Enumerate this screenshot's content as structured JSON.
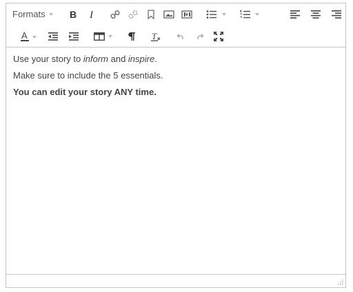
{
  "toolbar": {
    "formats_label": "Formats",
    "row1": [
      "bold-icon",
      "italic-icon",
      "link-icon",
      "unlink-icon",
      "bookmark-icon",
      "image-icon",
      "media-icon",
      "bullet-list-icon",
      "numbered-list-icon",
      "align-left-icon",
      "align-center-icon",
      "align-right-icon"
    ],
    "row2": [
      "text-color-icon",
      "outdent-icon",
      "indent-icon",
      "table-icon",
      "paragraph-icon",
      "clear-format-icon",
      "undo-icon",
      "redo-icon",
      "fullscreen-icon"
    ]
  },
  "content": {
    "line1": {
      "prefix": "Use your story to ",
      "em1": "inform",
      "mid": " and ",
      "em2": "inspire",
      "suffix": "."
    },
    "line2": "Make sure to include the 5 essentials.",
    "line3": "You can edit your story ANY time."
  },
  "colors": {
    "border": "#c5c5c5",
    "icon": "#5a5a5a",
    "text": "#444444",
    "background": "#ffffff"
  }
}
